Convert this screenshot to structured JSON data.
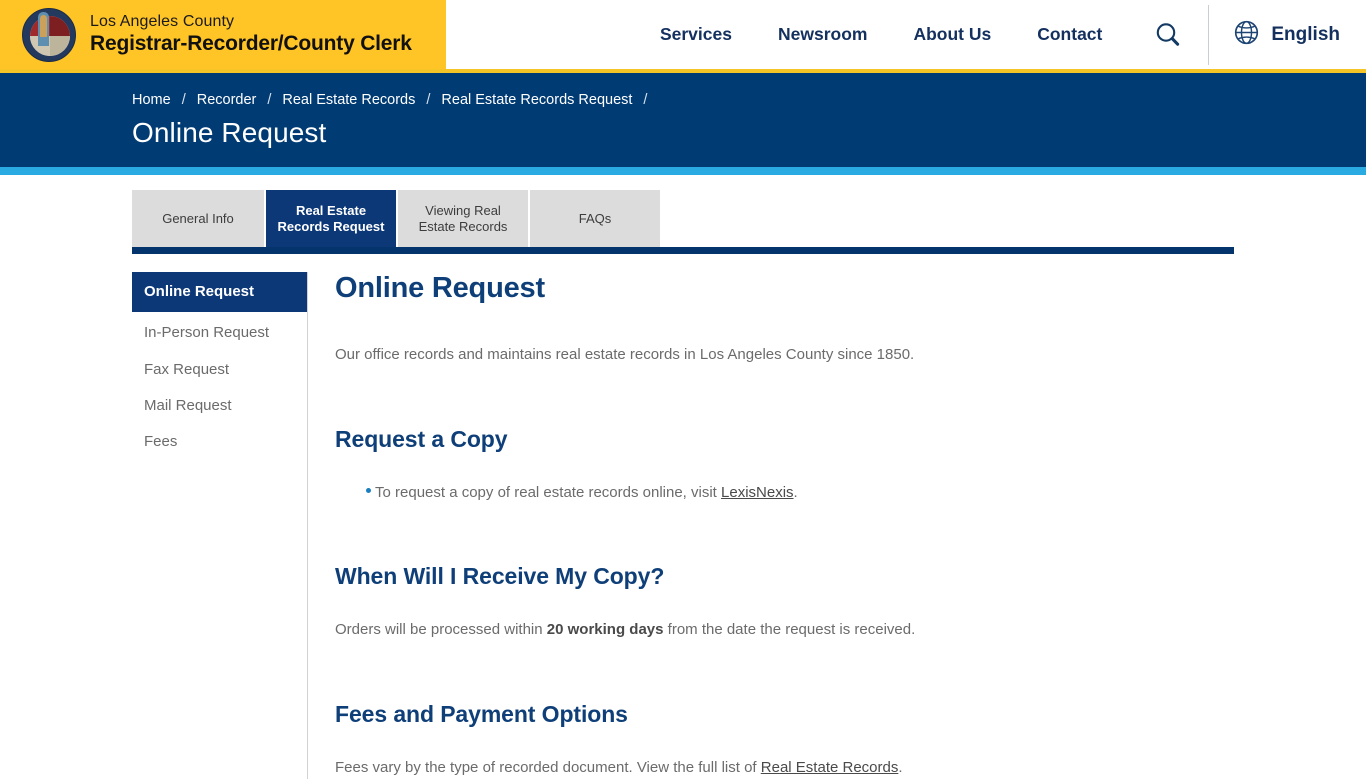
{
  "header": {
    "brand": {
      "line1": "Los Angeles County",
      "line2": "Registrar-Recorder/County Clerk",
      "seal_icon": "county-seal-icon"
    },
    "nav": [
      {
        "label": "Services"
      },
      {
        "label": "Newsroom"
      },
      {
        "label": "About Us"
      },
      {
        "label": "Contact"
      }
    ],
    "search_icon": "search-icon",
    "language": {
      "icon": "globe-icon",
      "label": "English"
    }
  },
  "band": {
    "breadcrumb": [
      {
        "label": "Home"
      },
      {
        "label": "Recorder"
      },
      {
        "label": "Real Estate Records"
      },
      {
        "label": "Real Estate Records Request"
      }
    ],
    "separator": "/",
    "title": "Online Request"
  },
  "tabs": [
    {
      "label": "General Info",
      "active": false
    },
    {
      "label": "Real Estate Records Request",
      "active": true
    },
    {
      "label": "Viewing Real Estate Records",
      "active": false
    },
    {
      "label": "FAQs",
      "active": false
    }
  ],
  "sidebar": {
    "items": [
      {
        "label": "Online Request",
        "active": true
      },
      {
        "label": "In-Person Request",
        "active": false
      },
      {
        "label": "Fax Request",
        "active": false
      },
      {
        "label": "Mail Request",
        "active": false
      },
      {
        "label": "Fees",
        "active": false
      }
    ]
  },
  "main": {
    "title": "Online Request",
    "intro": "Our office records and maintains real estate records in Los Angeles County since 1850.",
    "sections": [
      {
        "heading": "Request a Copy",
        "bullet_prefix": "To request a copy of real estate records online, visit ",
        "bullet_link": "LexisNexis",
        "bullet_suffix": "."
      },
      {
        "heading": "When Will I Receive My Copy?",
        "text_prefix": "Orders will be processed within ",
        "text_bold": "20 working days",
        "text_suffix": " from the date the request is received."
      },
      {
        "heading": "Fees and Payment Options",
        "text_prefix": "Fees vary by the type of recorded document. View the full list of ",
        "text_link": "Real Estate Records",
        "text_suffix": "."
      }
    ]
  },
  "colors": {
    "brand_yellow": "#ffc425",
    "navy": "#013b74",
    "navy_dark": "#0d3878",
    "cyan": "#29abe2",
    "heading_blue": "#0f3f78",
    "body_gray": "#6b6b6b"
  }
}
